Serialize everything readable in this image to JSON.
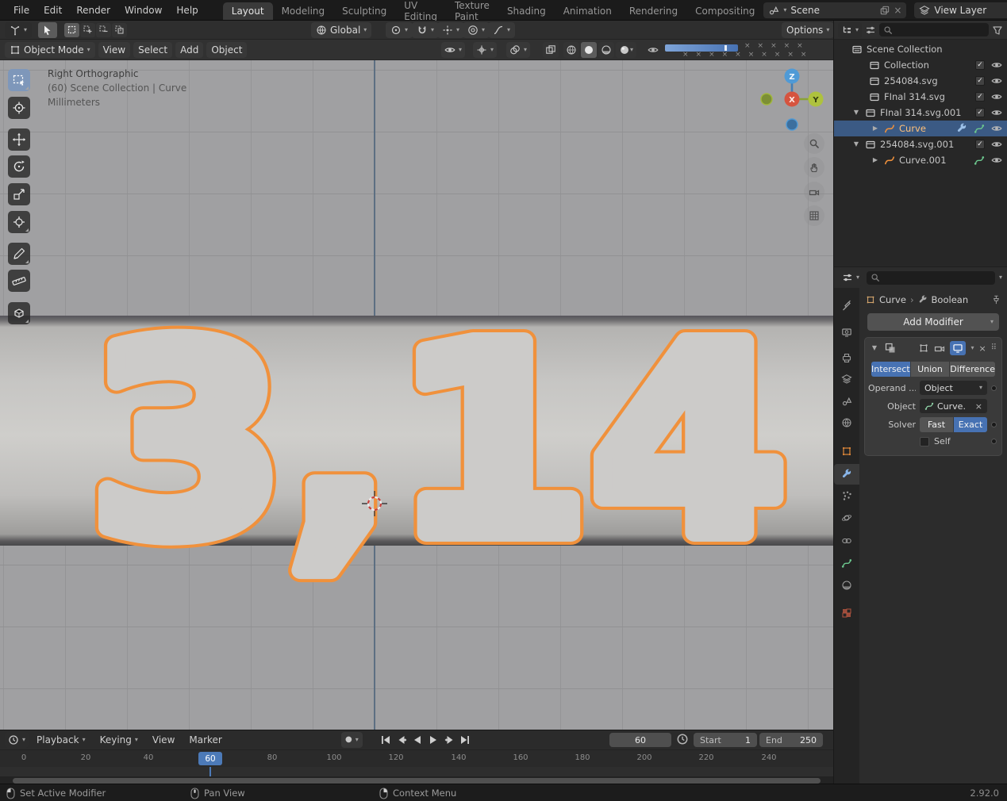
{
  "topbar": {
    "menus": [
      "File",
      "Edit",
      "Render",
      "Window",
      "Help"
    ],
    "tabs": [
      "Layout",
      "Modeling",
      "Sculpting",
      "UV Editing",
      "Texture Paint",
      "Shading",
      "Animation",
      "Rendering",
      "Compositing"
    ],
    "active_tab": "Layout",
    "scene_selector": "Scene",
    "view_layer_selector": "View Layer"
  },
  "tool_header": {
    "transform_orientation": "Global",
    "options": "Options"
  },
  "viewport": {
    "header": {
      "mode_selector": "Object Mode",
      "menus": [
        "View",
        "Select",
        "Add",
        "Object"
      ]
    },
    "overlay": {
      "line1": "Right Orthographic",
      "line2": "(60) Scene Collection | Curve",
      "line3": "Millimeters"
    },
    "gizmo": {
      "x": "X",
      "y": "Y",
      "z": "Z"
    },
    "scene_text": "3,14",
    "colors": {
      "selection_outline": "#f0913c",
      "object_fill": "#cccbc9"
    }
  },
  "outliner": {
    "root": "Scene Collection",
    "items": [
      {
        "label": "Collection"
      },
      {
        "label": "254084.svg"
      },
      {
        "label": "FInal 314.svg"
      },
      {
        "label": "FInal 314.svg.001"
      },
      {
        "label": "Curve",
        "selected": true
      },
      {
        "label": "254084.svg.001"
      },
      {
        "label": "Curve.001"
      }
    ]
  },
  "properties": {
    "breadcrumb": {
      "object": "Curve",
      "modifier": "Boolean"
    },
    "add_modifier": "Add Modifier",
    "modifier": {
      "operations": [
        "Intersect",
        "Union",
        "Difference"
      ],
      "active_operation": "Intersect",
      "operand_label": "Operand ...",
      "operand_value": "Object",
      "object_label": "Object",
      "object_value": "Curve.",
      "solver_label": "Solver",
      "solver_options": [
        "Fast",
        "Exact"
      ],
      "active_solver": "Exact",
      "self_label": "Self"
    }
  },
  "timeline": {
    "menus": [
      "Playback",
      "Keying",
      "View",
      "Marker"
    ],
    "current_frame": "60",
    "start_label": "Start",
    "start_value": "1",
    "end_label": "End",
    "end_value": "250",
    "ticks": [
      "0",
      "20",
      "40",
      "60",
      "80",
      "100",
      "120",
      "140",
      "160",
      "180",
      "200",
      "220",
      "240"
    ]
  },
  "statusbar": {
    "hint_left": "Set Active Modifier",
    "hint_middle": "Pan View",
    "hint_right": "Context Menu",
    "version": "2.92.0"
  },
  "icons": {
    "chevron_down": "▾",
    "triangle_open": "▼",
    "triangle_closed": "▶",
    "close": "×",
    "check": "✓",
    "breadcrumb_separator": "›",
    "record_dot": "●",
    "drag_handle": "⠿"
  }
}
